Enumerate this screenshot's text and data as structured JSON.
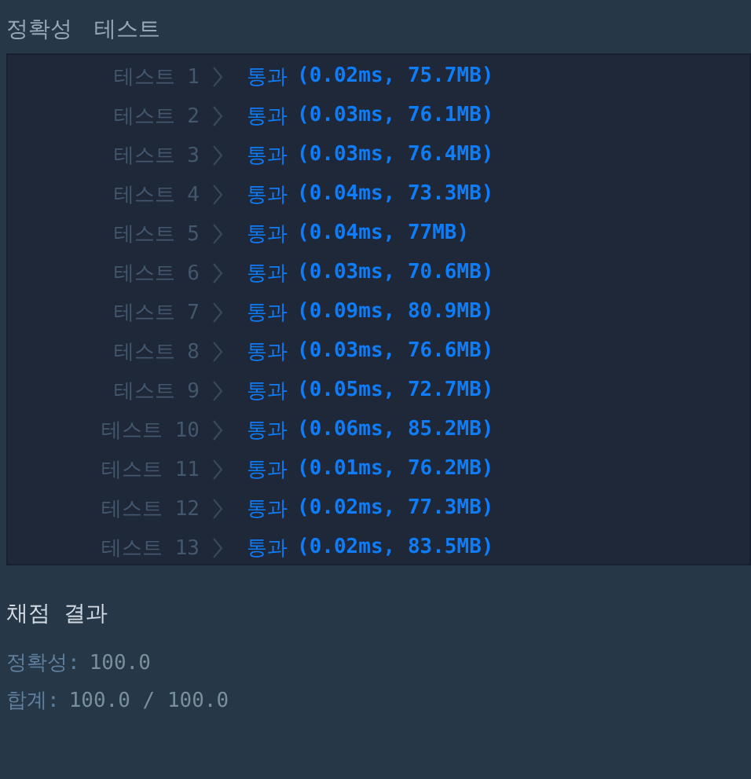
{
  "header": {
    "title": "정확성",
    "subtitle": "테스트"
  },
  "tests": [
    {
      "label": "테스트 1",
      "result": "통과",
      "detail": "(0.02ms, 75.7MB)"
    },
    {
      "label": "테스트 2",
      "result": "통과",
      "detail": "(0.03ms, 76.1MB)"
    },
    {
      "label": "테스트 3",
      "result": "통과",
      "detail": "(0.03ms, 76.4MB)"
    },
    {
      "label": "테스트 4",
      "result": "통과",
      "detail": "(0.04ms, 73.3MB)"
    },
    {
      "label": "테스트 5",
      "result": "통과",
      "detail": "(0.04ms, 77MB)"
    },
    {
      "label": "테스트 6",
      "result": "통과",
      "detail": "(0.03ms, 70.6MB)"
    },
    {
      "label": "테스트 7",
      "result": "통과",
      "detail": "(0.09ms, 80.9MB)"
    },
    {
      "label": "테스트 8",
      "result": "통과",
      "detail": "(0.03ms, 76.6MB)"
    },
    {
      "label": "테스트 9",
      "result": "통과",
      "detail": "(0.05ms, 72.7MB)"
    },
    {
      "label": "테스트 10",
      "result": "통과",
      "detail": "(0.06ms, 85.2MB)"
    },
    {
      "label": "테스트 11",
      "result": "통과",
      "detail": "(0.01ms, 76.2MB)"
    },
    {
      "label": "테스트 12",
      "result": "통과",
      "detail": "(0.02ms, 77.3MB)"
    },
    {
      "label": "테스트 13",
      "result": "통과",
      "detail": "(0.02ms, 83.5MB)"
    }
  ],
  "summary": {
    "title": "채점 결과",
    "lines": [
      {
        "label": "정확성:",
        "value": "100.0"
      },
      {
        "label": "합계:",
        "value": "100.0 / 100.0"
      }
    ]
  }
}
